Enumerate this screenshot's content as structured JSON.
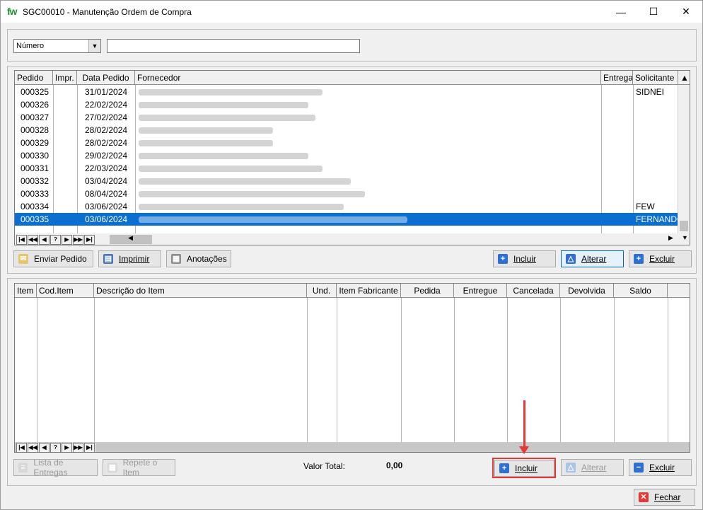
{
  "window": {
    "logo": "fw",
    "title": "SGC00010 - Manutenção Ordem de Compra"
  },
  "titlebar_buttons": {
    "minimize": "—",
    "maximize": "☐",
    "close": "✕"
  },
  "filter": {
    "field_selected": "Número",
    "dropdown_arrow": "▼",
    "search_value": ""
  },
  "orders": {
    "columns": [
      "Pedido",
      "Impr.",
      "Data Pedido",
      "Fornecedor",
      "Entrega",
      "Solicitante"
    ],
    "rows": [
      {
        "pedido": "000325",
        "data": "31/01/2024",
        "solicitante": "SIDNEI"
      },
      {
        "pedido": "000326",
        "data": "22/02/2024",
        "solicitante": ""
      },
      {
        "pedido": "000327",
        "data": "27/02/2024",
        "solicitante": ""
      },
      {
        "pedido": "000328",
        "data": "28/02/2024",
        "solicitante": ""
      },
      {
        "pedido": "000329",
        "data": "28/02/2024",
        "solicitante": ""
      },
      {
        "pedido": "000330",
        "data": "29/02/2024",
        "solicitante": ""
      },
      {
        "pedido": "000331",
        "data": "22/03/2024",
        "solicitante": ""
      },
      {
        "pedido": "000332",
        "data": "03/04/2024",
        "solicitante": ""
      },
      {
        "pedido": "000333",
        "data": "08/04/2024",
        "solicitante": ""
      },
      {
        "pedido": "000334",
        "data": "03/06/2024",
        "solicitante": "FEW"
      },
      {
        "pedido": "000335",
        "data": "03/06/2024",
        "solicitante": "FERNANDO"
      }
    ],
    "selected_row": "000335"
  },
  "navigator": [
    "|◀",
    "◀◀",
    "◀",
    "?",
    "▶",
    "▶▶",
    "▶|"
  ],
  "order_buttons": {
    "enviar": "Enviar Pedido",
    "imprimir": "Imprimir",
    "anotacoes": "Anotações",
    "incluir": "Incluir",
    "alterar": "Alterar",
    "excluir": "Excluir"
  },
  "items": {
    "columns": [
      "Item",
      "Cod.Item",
      "Descrição do Item",
      "Und.",
      "Item Fabricante",
      "Pedida",
      "Entregue",
      "Cancelada",
      "Devolvida",
      "Saldo"
    ]
  },
  "item_buttons": {
    "lista_entregas": "Lista de Entregas",
    "repete_item": "Repete o Item",
    "valor_total_label": "Valor Total:",
    "valor_total": "0,00",
    "incluir": "Incluir",
    "alterar": "Alterar",
    "excluir": "Excluir"
  },
  "footer": {
    "fechar": "Fechar"
  },
  "colors": {
    "selection": "#0a6fd1",
    "highlight": "#e53935",
    "logo": "#1f8f3a"
  }
}
